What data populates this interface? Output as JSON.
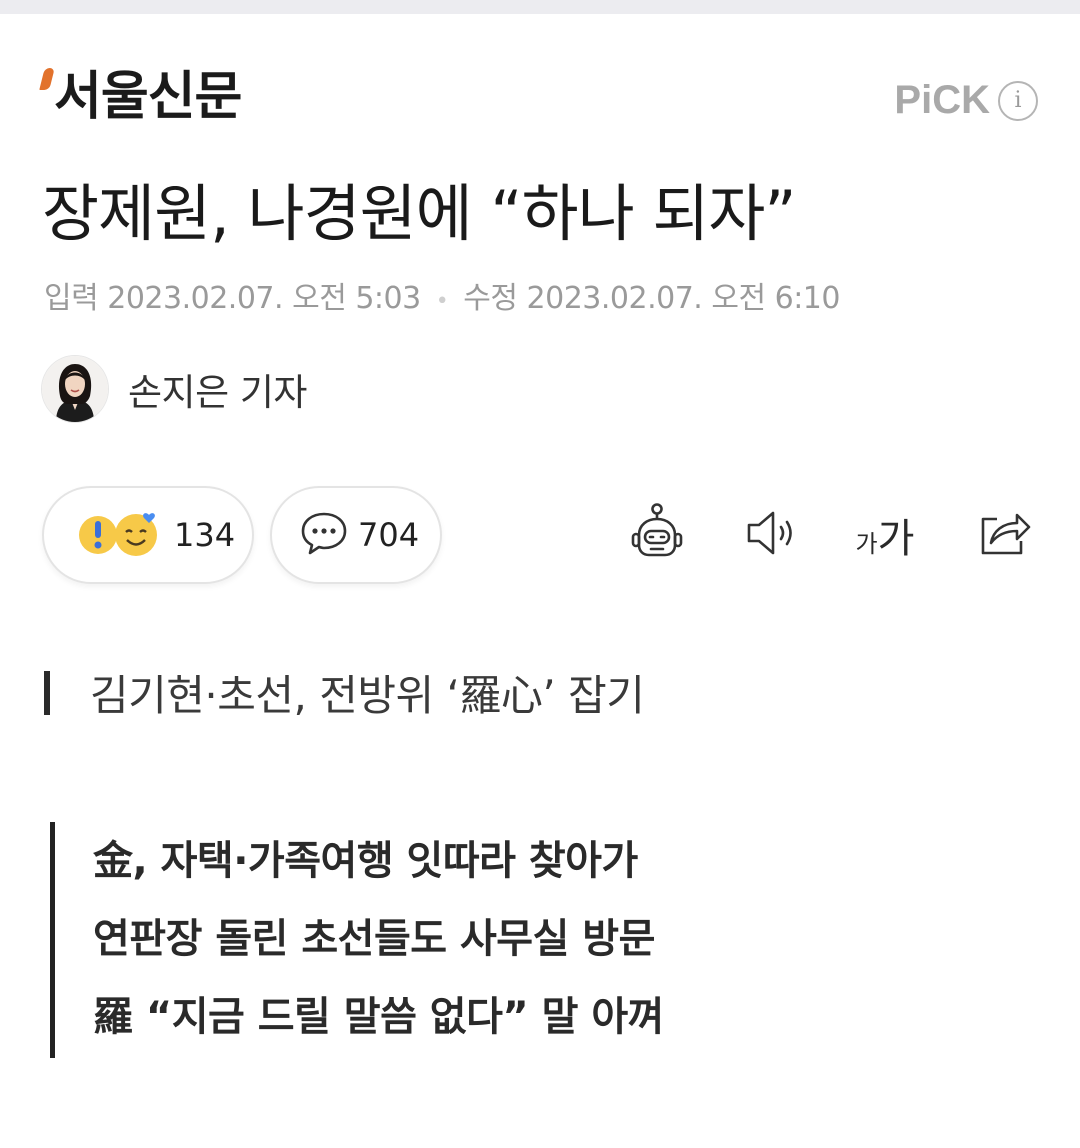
{
  "header": {
    "press_name": "서울신문",
    "pick_label": "PiCK",
    "info_symbol": "i"
  },
  "article": {
    "headline": "장제원, 나경원에 “하나 되자”",
    "date_input_label": "입력",
    "date_input_value": "2023.02.07. 오전 5:03",
    "date_modified_label": "수정",
    "date_modified_value": "2023.02.07. 오전 6:10",
    "reporter": "손지은 기자",
    "subheadline": "김기현·초선, 전방위 ‘羅心’ 잡기",
    "summary": [
      "金, 자택·가족여행 잇따라 찾아가",
      "연판장 돌린 초선들도 사무실 방문",
      "羅 “지금 드릴 말씀 없다” 말 아껴"
    ]
  },
  "actions": {
    "reaction_count": "134",
    "comment_count": "704",
    "font_small_glyph": "가",
    "font_big_glyph": "가"
  },
  "icons": {
    "reaction": "reaction-emoji-icon",
    "comment": "comment-bubble-icon",
    "summary_bot": "robot-summary-icon",
    "tts": "speaker-icon",
    "font_size": "font-size-icon",
    "share": "share-icon"
  },
  "colors": {
    "logo_accent": "#e2722c",
    "pick_gray": "#a9a9a9",
    "meta_gray": "#9a9a9a",
    "text_dark": "#1a1a1a"
  }
}
